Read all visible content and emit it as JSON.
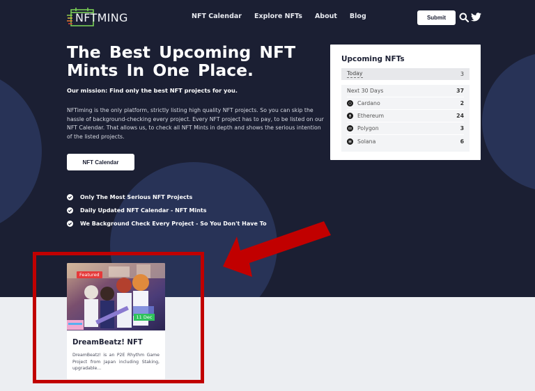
{
  "header": {
    "logo_prefix": "NFT",
    "logo_suffix": "MING",
    "nav": [
      "NFT Calendar",
      "Explore NFTs",
      "About",
      "Blog"
    ],
    "submit_label": "Submit",
    "icons": [
      "search-icon",
      "twitter-icon"
    ]
  },
  "hero": {
    "title": "The Best Upcoming NFT Mints In One Place.",
    "mission": "Our mission: Find only the best NFT projects for you.",
    "description": "NFTiming is the only platform, strictly listing high quality NFT projects. So you can skip the hassle of background-checking every project. Every NFT project has to pay, to be listed on our NFT Calendar. That allows us, to check all NFT Mints in depth and shows the serious intention of the listed projects.",
    "cta_label": "NFT Calendar",
    "features": [
      "Only The Most Serious NFT Projects",
      "Daily Updated NFT Calendar - NFT Mints",
      "We Background Check Every Project - So You Don't Have To"
    ]
  },
  "upcoming": {
    "title": "Upcoming NFTs",
    "today": {
      "label": "Today",
      "value": "3"
    },
    "rows": [
      {
        "label": "Next 30 Days",
        "value": "37",
        "icon": ""
      },
      {
        "label": "Cardano",
        "value": "2",
        "icon": "cardano-icon"
      },
      {
        "label": "Ethereum",
        "value": "24",
        "icon": "ethereum-icon"
      },
      {
        "label": "Polygon",
        "value": "3",
        "icon": "polygon-icon"
      },
      {
        "label": "Solana",
        "value": "6",
        "icon": "solana-icon"
      }
    ]
  },
  "card": {
    "badge": "Featured",
    "date": "11 Dec",
    "title": "DreamBeatz! NFT",
    "description": "DreamBeatz! is an P2E Rhythm Game Project from Japan including Staking, upgradable..."
  },
  "colors": {
    "hero_bg": "#1b1f33",
    "circle": "#283357",
    "page_bg": "#eceef2",
    "annotation_red": "#c10000",
    "featured_badge": "#e53a3a",
    "date_badge": "#2fc25c"
  }
}
